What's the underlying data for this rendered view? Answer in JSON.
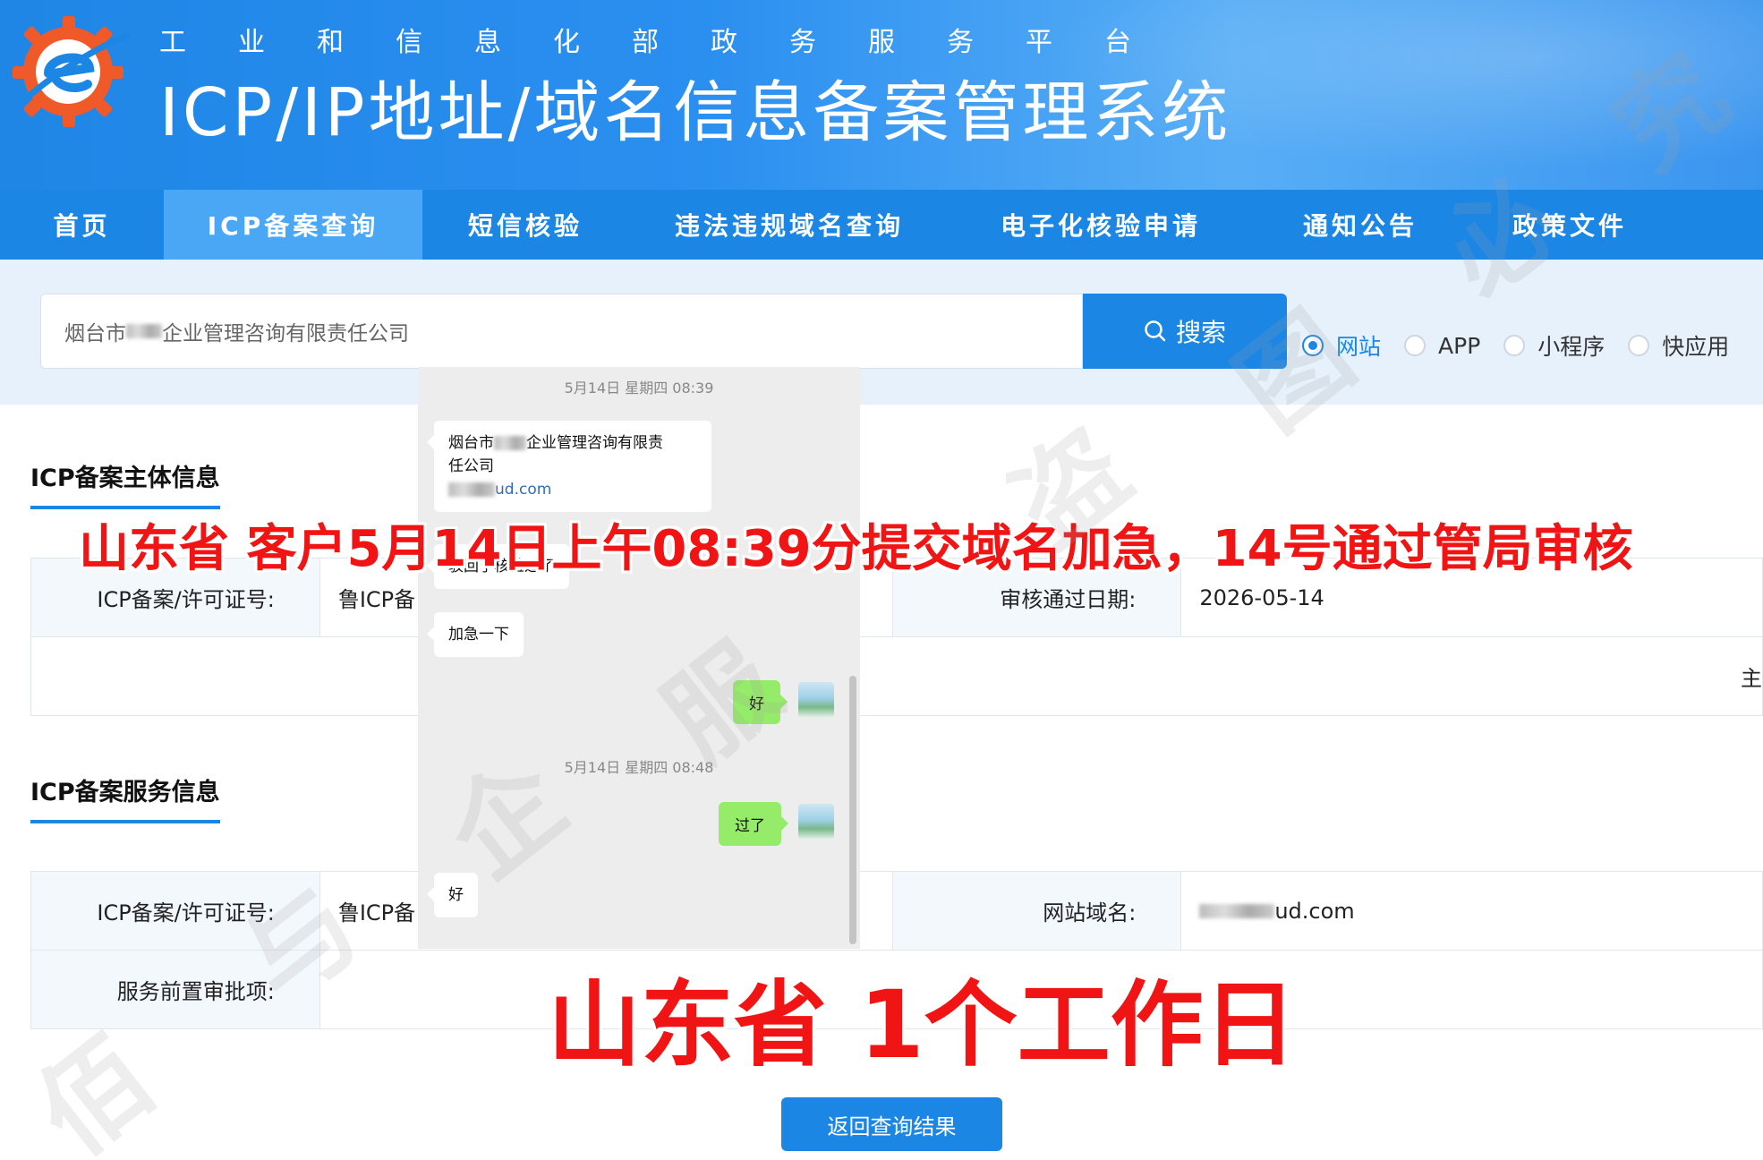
{
  "header": {
    "subtitle": "工业和信息化部政务服务平台",
    "title": "ICP/IP地址/域名信息备案管理系统",
    "logo_icon": "gear-e-logo-icon",
    "logo_colors": [
      "#f05a28",
      "#1b86e4"
    ]
  },
  "nav": {
    "items": [
      {
        "label": "首页"
      },
      {
        "label": "ICP备案查询",
        "active": true
      },
      {
        "label": "短信核验"
      },
      {
        "label": "违法违规域名查询"
      },
      {
        "label": "电子化核验申请"
      },
      {
        "label": "通知公告"
      },
      {
        "label": "政策文件"
      }
    ]
  },
  "search": {
    "value_prefix": "烟台市",
    "value_suffix": "企业管理咨询有限责任公司",
    "button_label": "搜索",
    "options": [
      {
        "label": "网站",
        "checked": true
      },
      {
        "label": "APP",
        "checked": false
      },
      {
        "label": "小程序",
        "checked": false
      },
      {
        "label": "快应用",
        "checked": false
      }
    ]
  },
  "subject_section": {
    "title": "ICP备案主体信息",
    "license_label": "ICP备案/许可证号:",
    "license_value": "鲁ICP备",
    "approve_date_label": "审核通过日期:",
    "approve_date_value": "2026-05-14",
    "row2_edge_text": "主"
  },
  "service_section": {
    "title": "ICP备案服务信息",
    "license_label": "ICP备案/许可证号:",
    "license_value": "鲁ICP备",
    "domain_label": "网站域名:",
    "domain_value_suffix": "ud.com",
    "preapproval_label": "服务前置审批项:"
  },
  "chat": {
    "time1": "5月14日 星期四 08:39",
    "msg1_line1_prefix": "烟台市",
    "msg1_line1_suffix": "企业管理咨询有限责",
    "msg1_line2": "任公司",
    "msg1_link_suffix": "ud.com",
    "msg2": "驳回了核验过了",
    "msg3": "加急一下",
    "reply1": "好",
    "time2": "5月14日 星期四 08:48",
    "reply2": "过了",
    "msg4": "好"
  },
  "annotations": {
    "top": "山东省 客户5月14日上午08:39分提交域名加急，14号通过管局审核",
    "bottom": "山东省 1个工作日",
    "color": "#f01414"
  },
  "watermark": [
    "佰",
    "与",
    "企",
    "服",
    "盗",
    "图",
    "必",
    "究"
  ],
  "back_button_label": "返回查询结果"
}
